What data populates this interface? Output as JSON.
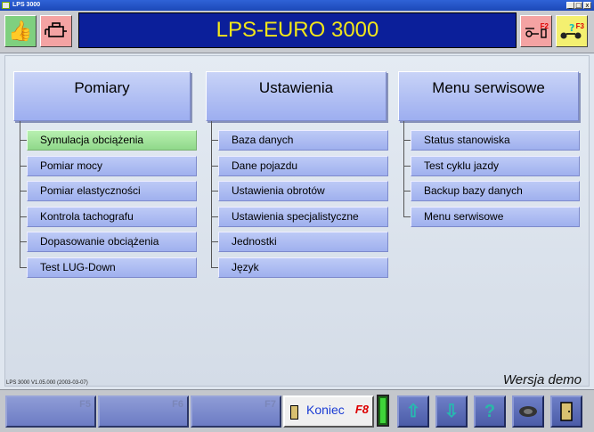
{
  "window": {
    "title": "LPS 3000",
    "minimize": "_",
    "maximize": "□",
    "close": "x"
  },
  "header": {
    "banner": "LPS-EURO 3000",
    "f2_label": "F2",
    "f3_label": "F3",
    "icons": [
      "thumbs-up-icon",
      "engine-icon",
      "car-key-icon",
      "trailer-help-icon"
    ]
  },
  "columns": [
    {
      "title": "Pomiary",
      "items": [
        "Symulacja obciążenia",
        "Pomiar mocy",
        "Pomiar elastyczności",
        "Kontrola tachografu",
        "Dopasowanie obciążenia",
        "Test LUG-Down"
      ]
    },
    {
      "title": "Ustawienia",
      "items": [
        "Baza danych",
        "Dane pojazdu",
        "Ustawienia obrotów",
        "Ustawienia specjalistyczne",
        "Jednostki",
        "Język"
      ]
    },
    {
      "title": "Menu serwisowe",
      "items": [
        "Status stanowiska",
        "Test cyklu jazdy",
        "Backup bazy danych",
        "Menu serwisowe"
      ]
    }
  ],
  "active_item": "Symulacja obciążenia",
  "status": {
    "version": "LPS 3000 V1.05.000 (2003-03-07)",
    "demo": "Wersja demo"
  },
  "footer": {
    "f5": "F5",
    "f6": "F6",
    "f7": "F7",
    "exit_label": "Koniec",
    "exit_key": "F8"
  },
  "colors": {
    "banner_bg": "#0b1f9a",
    "banner_text": "#f2e61a",
    "active_item": "#9fe096",
    "menu_item": "#aebcf2"
  }
}
